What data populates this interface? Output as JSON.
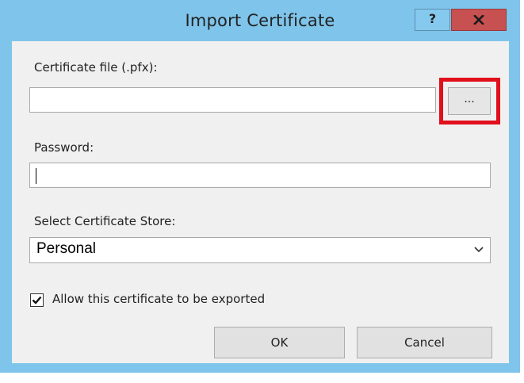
{
  "window": {
    "title": "Import Certificate",
    "help_label": "?"
  },
  "form": {
    "certificate_file_label": "Certificate file (.pfx):",
    "certificate_file_value": "",
    "browse_label": "...",
    "password_label": "Password:",
    "password_value": "",
    "store_label": "Select Certificate Store:",
    "store_selected": "Personal",
    "exportable_label": "Allow this certificate to be exported",
    "exportable_checked": true
  },
  "buttons": {
    "ok_label": "OK",
    "cancel_label": "Cancel"
  },
  "colors": {
    "frame": "#7fc4ea",
    "close_button": "#c75050",
    "highlight": "#e0101c",
    "client_background": "#f0f0f0"
  },
  "icons": {
    "close": "close-icon",
    "dropdown": "chevron-down-icon",
    "checkbox": "checkmark-icon"
  }
}
